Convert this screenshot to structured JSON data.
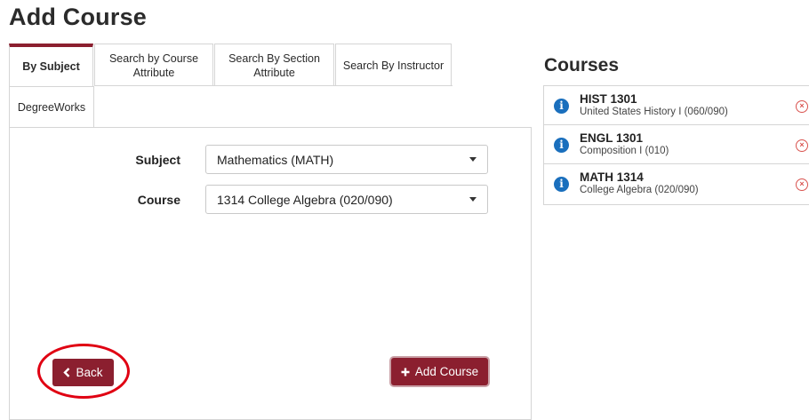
{
  "page": {
    "title": "Add Course"
  },
  "tabs": [
    {
      "label": "By Subject"
    },
    {
      "label": "Search by Course Attribute"
    },
    {
      "label": "Search By Section Attribute"
    },
    {
      "label": "Search By Instructor"
    },
    {
      "label": "DegreeWorks"
    }
  ],
  "active_tab": "By Subject",
  "form": {
    "subject_label": "Subject",
    "subject_value": "Mathematics (MATH)",
    "course_label": "Course",
    "course_value": "1314 College Algebra (020/090)"
  },
  "buttons": {
    "back_label": "Back",
    "add_label": "Add Course"
  },
  "courses": {
    "heading": "Courses",
    "items": [
      {
        "code": "HIST 1301",
        "title": "United States History I (060/090)"
      },
      {
        "code": "ENGL 1301",
        "title": "Composition I (010)"
      },
      {
        "code": "MATH 1314",
        "title": "College Algebra (020/090)"
      }
    ]
  },
  "colors": {
    "accent": "#8b1f2f",
    "info_icon": "#1a6fbd",
    "remove_icon": "#d9534f",
    "highlight": "#e00012"
  },
  "icons": {
    "back": "chevron-left-icon",
    "add": "plus-icon",
    "info": "info-icon",
    "remove": "remove-circle-icon"
  }
}
